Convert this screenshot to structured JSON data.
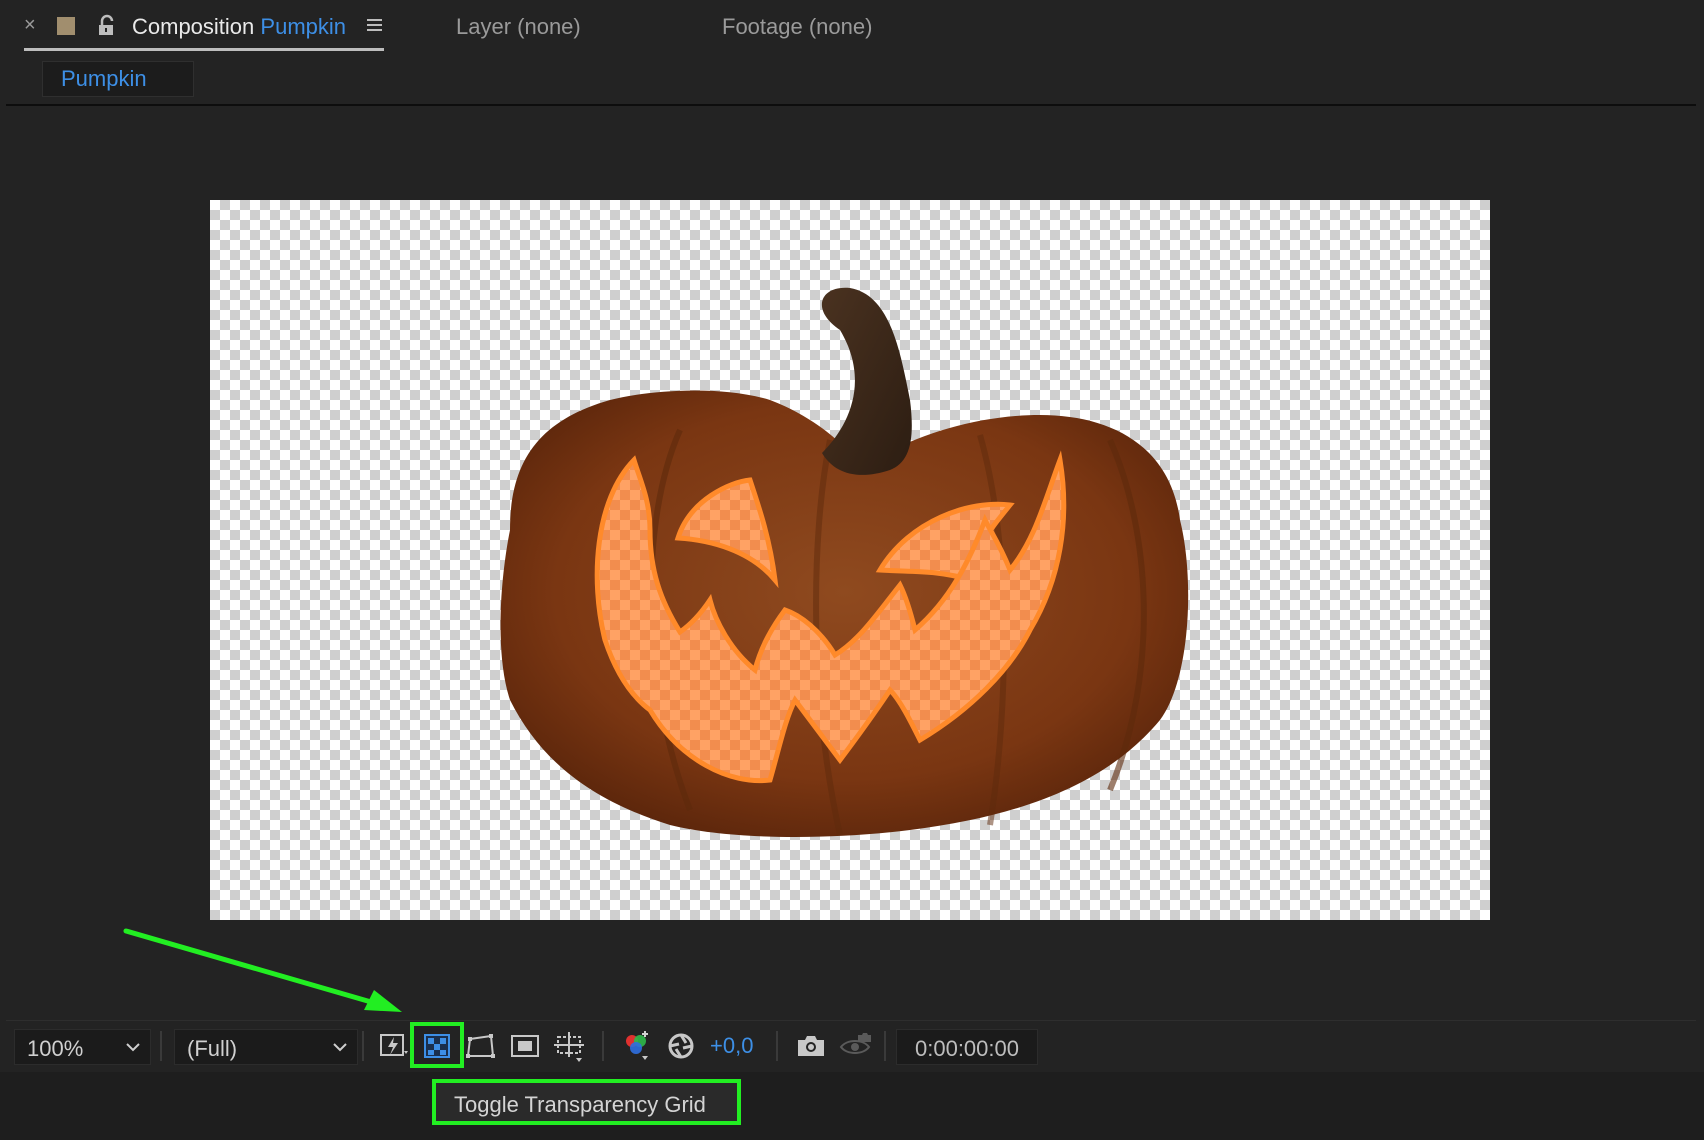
{
  "tabs": {
    "close_glyph": "×",
    "composition_label": "Composition",
    "composition_name": "Pumpkin",
    "layer_tab": "Layer (none)",
    "footage_tab": "Footage (none)"
  },
  "subtab": {
    "label": "Pumpkin"
  },
  "toolbar": {
    "zoom": "100%",
    "resolution": "(Full)",
    "exposure": "+0,0",
    "timecode": "0:00:00:00"
  },
  "tooltip": {
    "text": "Toggle Transparency Grid"
  },
  "colors": {
    "accent_blue": "#3d8fe6",
    "highlight_green": "#22ee22",
    "pumpkin_orange": "#8a3f17",
    "glow_orange": "#ff9a4a"
  },
  "icons": [
    "close-icon",
    "label-color-swatch",
    "lock-icon",
    "panel-menu-icon",
    "chevron-down-icon",
    "fast-preview-icon",
    "transparency-grid-icon",
    "mask-path-visibility-icon",
    "region-of-interest-icon",
    "guides-options-icon",
    "show-channel-icon",
    "exposure-reset-icon",
    "snapshot-icon",
    "show-snapshot-icon"
  ]
}
